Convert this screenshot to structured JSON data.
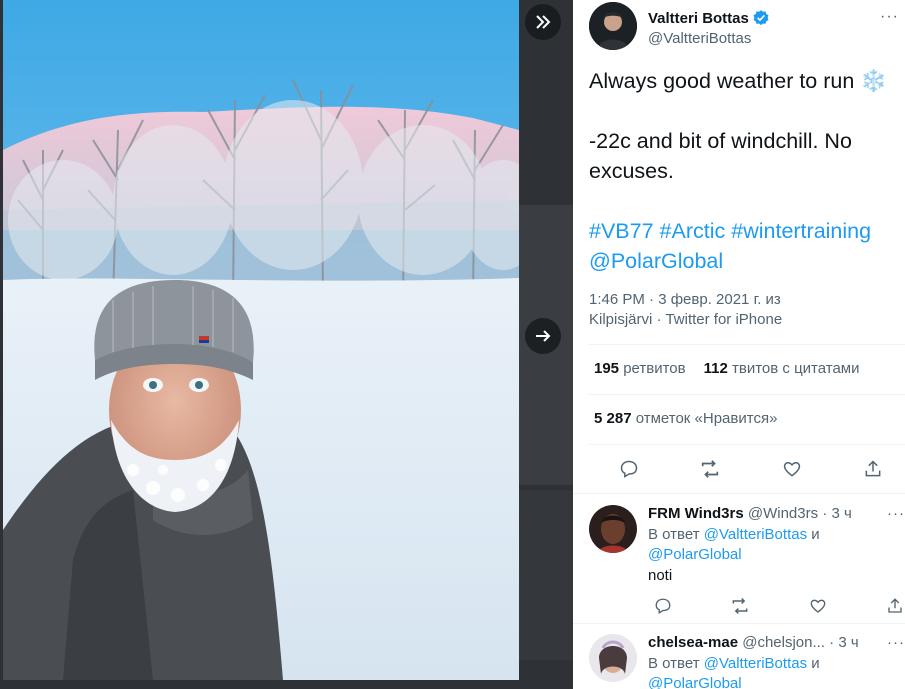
{
  "colors": {
    "accent": "#1d9bf0",
    "text": "#0f1419",
    "muted": "#536471",
    "verified": "#1d9bf0"
  },
  "viewer": {
    "expand_icon": "chevron-double-right-icon",
    "next_icon": "arrow-right-icon"
  },
  "tweet": {
    "author_name": "Valtteri Bottas",
    "author_handle": "@ValtteriBottas",
    "text_line1": "Always good weather to run ❄️",
    "text_line2": "-22c and bit of windchill. No excuses.",
    "hashtags": [
      "#VB77",
      "#Arctic",
      "#wintertraining"
    ],
    "mention": "@PolarGlobal",
    "timestamp": "1:46 PM · 3 февр. 2021 г. из",
    "location": "Kilpisjärvi",
    "source": "Twitter for iPhone",
    "retweets_count": "195",
    "retweets_label": "ретвитов",
    "quotes_count": "112",
    "quotes_label": "твитов с цитатами",
    "likes_count": "5 287",
    "likes_label": "отметок «Нравится»"
  },
  "replies": [
    {
      "name": "FRM Wind3rs",
      "handle": "@Wind3rs",
      "time": "3 ч",
      "context_prefix": "В ответ",
      "mention_1": "@ValtteriBottas",
      "conj": "и",
      "mention_2": "@PolarGlobal",
      "text": "noti"
    },
    {
      "name": "chelsea-mae",
      "handle": "@chelsjon...",
      "time": "3 ч",
      "context_prefix": "В ответ",
      "mention_1": "@ValtteriBottas",
      "conj": "и",
      "mention_2": "@PolarGlobal"
    }
  ]
}
